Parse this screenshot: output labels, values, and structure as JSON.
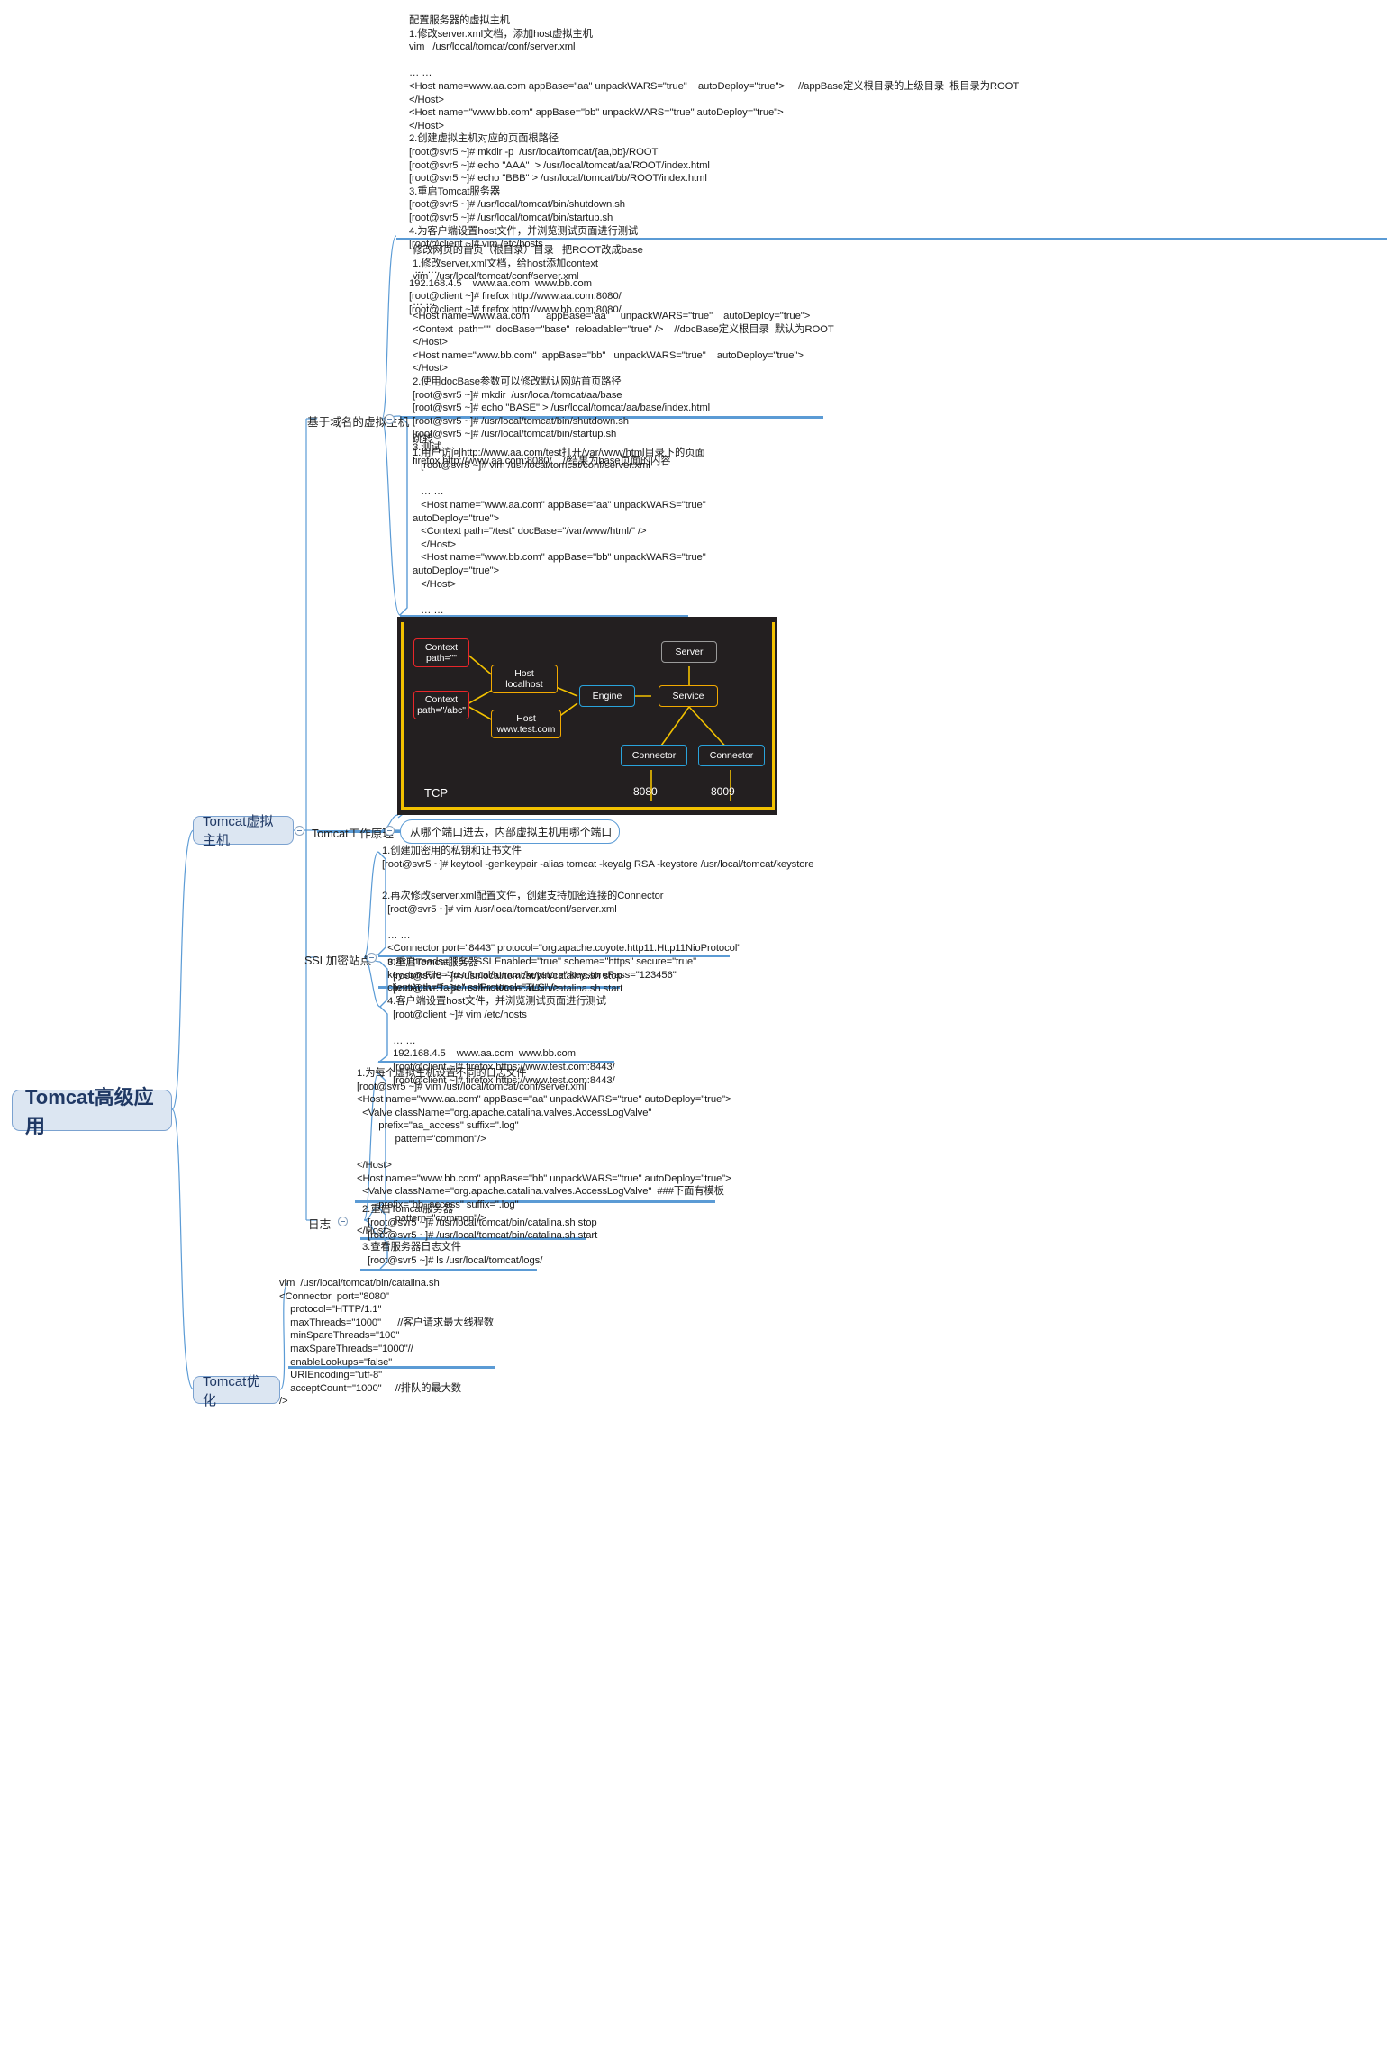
{
  "colors": {
    "accent": "#5b9bd5",
    "node_fill": "#dce6f2",
    "node_border": "#7ba2d0",
    "node_text": "#1f3864",
    "diagram_bg": "#231f20",
    "diagram_yellow": "#f2c100",
    "diagram_red": "#e8262a",
    "diagram_amber": "#f2a900",
    "diagram_blue": "#29a3dc",
    "diagram_grey": "#9b9b9b"
  },
  "root": {
    "label": "Tomcat高级应用"
  },
  "branches": [
    {
      "id": "virtual-host",
      "label": "Tomcat虚拟主机"
    },
    {
      "id": "optimize",
      "label": "Tomcat优化"
    }
  ],
  "sub_labels": {
    "domain_based": "基于域名的虚拟主机",
    "work_principle": "Tomcat工作原理",
    "ssl_site": "SSL加密站点",
    "logs": "日志"
  },
  "bubble": {
    "work_principle_note": "从哪个端口进去，内部虚拟主机用哪个端口"
  },
  "notes": {
    "config_vhost": "配置服务器的虚拟主机\n1.修改server.xml文档，添加host虚拟主机\nvim   /usr/local/tomcat/conf/server.xml\n\n… …\n<Host name=www.aa.com appBase=\"aa\" unpackWARS=\"true\"    autoDeploy=\"true\">     //appBase定义根目录的上级目录  根目录为ROOT\n</Host>\n<Host name=\"www.bb.com\" appBase=\"bb\" unpackWARS=\"true\" autoDeploy=\"true\">\n</Host>\n2.创建虚拟主机对应的页面根路径\n[root@svr5 ~]# mkdir -p  /usr/local/tomcat/{aa,bb}/ROOT\n[root@svr5 ~]# echo \"AAA\"  > /usr/local/tomcat/aa/ROOT/index.html\n[root@svr5 ~]# echo \"BBB\" > /usr/local/tomcat/bb/ROOT/index.html\n3.重启Tomcat服务器\n[root@svr5 ~]# /usr/local/tomcat/bin/shutdown.sh\n[root@svr5 ~]# /usr/local/tomcat/bin/startup.sh\n4.为客户端设置host文件，并浏览测试页面进行测试\n[root@client ~]# vim /etc/hosts\n\n  … …\n192.168.4.5    www.aa.com  www.bb.com\n[root@client ~]# firefox http://www.aa.com:8080/\n[root@client ~]# firefox http://www.bb.com:8080/",
    "change_home": "修改网页的首页（根目录）目录   把ROOT改成base\n1.修改server,xml文档，给host添加context\nvim   /usr/local/tomcat/conf/server.xml\n\n… …\n<Host name=www.aa.com      appBase=\"aa\"    unpackWARS=\"true\"    autoDeploy=\"true\">\n<Context  path=\"\"  docBase=\"base\"  reloadable=\"true\" />    //docBase定义根目录  默认为ROOT\n</Host>\n<Host name=\"www.bb.com\"  appBase=\"bb\"   unpackWARS=\"true\"    autoDeploy=\"true\">\n</Host>\n2.使用docBase参数可以修改默认网站首页路径\n[root@svr5 ~]# mkdir  /usr/local/tomcat/aa/base\n[root@svr5 ~]# echo \"BASE\" > /usr/local/tomcat/aa/base/index.html\n[root@svr5 ~]# /usr/local/tomcat/bin/shutdown.sh\n[root@svr5 ~]# /usr/local/tomcat/bin/startup.sh\n3.测试\nfirefox http://www.aa.com:8080/    //结果为base页面的内容",
    "redirect": "跳转\n1.用户访问http://www.aa.com/test打开/var/www/html目录下的页面\n   [root@svr5 ~]# vim /usr/local/tomcat/conf/server.xml\n\n   … …\n   <Host name=\"www.aa.com\" appBase=\"aa\" unpackWARS=\"true\"\nautoDeploy=\"true\">\n   <Context path=\"/test\" docBase=\"/var/www/html/\" />\n   </Host>\n   <Host name=\"www.bb.com\" appBase=\"bb\" unpackWARS=\"true\"\nautoDeploy=\"true\">\n   </Host>\n\n   … …\n   [root@svr5 ~]# echo \"Test\" > /var/www/html/index.html\n   [root@svr5 ~]# /usr/local/tomcat/bin/shutdown.sh\n   [root@svr5 ~]# /usr/local/tomcat/bin/startup.sh\n2.测试查看页面是否正确\n[root@client ~]# firefox http://www.aa.com:8080/test\n//返回/var/www/html/index.html的内容",
    "ssl_1": "1.创建加密用的私钥和证书文件\n[root@svr5 ~]# keytool -genkeypair -alias tomcat -keyalg RSA -keystore /usr/local/tomcat/keystore",
    "ssl_2": "2.再次修改server.xml配置文件，创建支持加密连接的Connector\n  [root@svr5 ~]# vim /usr/local/tomcat/conf/server.xml\n\n  … …\n  <Connector port=\"8443\" protocol=\"org.apache.coyote.http11.Http11NioProtocol\"\n  maxThreads=\"150\" SSLEnabled=\"true\" scheme=\"https\" secure=\"true\"\n  keystoreFile=\"/usr/local/tomcat/keystore\" keystorePass=\"123456\"\n  clientAuth=\"false\" sslProtocol=\"TLS\" />",
    "ssl_3": "3.重启Tomcat服务器\n  [root@svr5 ~]# /usr/local/tomcat/bin/catalina.sh stop\n  [root@svr5 ~]# /usr/local/tomcat/bin/catalina.sh start",
    "ssl_4": "4.客户端设置host文件，并浏览测试页面进行测试\n  [root@client ~]# vim /etc/hosts\n\n  … …\n  192.168.4.5    www.aa.com  www.bb.com\n  [root@client ~]# firefox https://www.test.com:8443/\n  [root@client ~]# firefox https://www.test.com:8443/",
    "log_1": "1.为每个虚拟主机设置不同的日志文件\n[root@svr5 ~]# vim /usr/local/tomcat/conf/server.xml\n<Host name=\"www.aa.com\" appBase=\"aa\" unpackWARS=\"true\" autoDeploy=\"true\">\n  <Valve className=\"org.apache.catalina.valves.AccessLogValve\"\n        prefix=\"aa_access\" suffix=\".log\"\n              pattern=\"common\"/>\n\n</Host>\n<Host name=\"www.bb.com\" appBase=\"bb\" unpackWARS=\"true\" autoDeploy=\"true\">\n  <Valve className=\"org.apache.catalina.valves.AccessLogValve\"  ###下面有模板\n        prefix=\"bb_access\" suffix=\".log\"\n              pattern=\"common\"/>\n</Host>",
    "log_2": "2.重启Tomcat服务器\n  [root@svr5 ~]# /usr/local/tomcat/bin/catalina.sh stop\n  [root@svr5 ~]# /usr/local/tomcat/bin/catalina.sh start",
    "log_3": "3.查看服务器日志文件\n  [root@svr5 ~]# ls /usr/local/tomcat/logs/",
    "optimize": "vim  /usr/local/tomcat/bin/catalina.sh\n<Connector  port=\"8080\"\n    protocol=\"HTTP/1.1\"\n    maxThreads=\"1000\"      //客户请求最大线程数\n    minSpareThreads=\"100\"\n    maxSpareThreads=\"1000\"//\n    enableLookups=\"false\"\n    URIEncoding=\"utf-8\"\n    acceptCount=\"1000\"     //排队的最大数\n/>"
  },
  "diagram": {
    "title_tcp": "TCP",
    "ports": [
      "8080",
      "8009"
    ],
    "nodes": [
      {
        "id": "context-root",
        "label": "Context\npath=\"\"",
        "color": "red"
      },
      {
        "id": "context-abc",
        "label": "Context\npath=\"/abc\"",
        "color": "red"
      },
      {
        "id": "host-localhost",
        "label": "Host\nlocalhost",
        "color": "amber"
      },
      {
        "id": "host-test",
        "label": "Host\nwww.test.com",
        "color": "amber"
      },
      {
        "id": "engine",
        "label": "Engine",
        "color": "blue"
      },
      {
        "id": "service",
        "label": "Service",
        "color": "amber"
      },
      {
        "id": "server",
        "label": "Server",
        "color": "grey"
      },
      {
        "id": "connector-1",
        "label": "Connector",
        "color": "blue"
      },
      {
        "id": "connector-2",
        "label": "Connector",
        "color": "blue"
      }
    ]
  }
}
